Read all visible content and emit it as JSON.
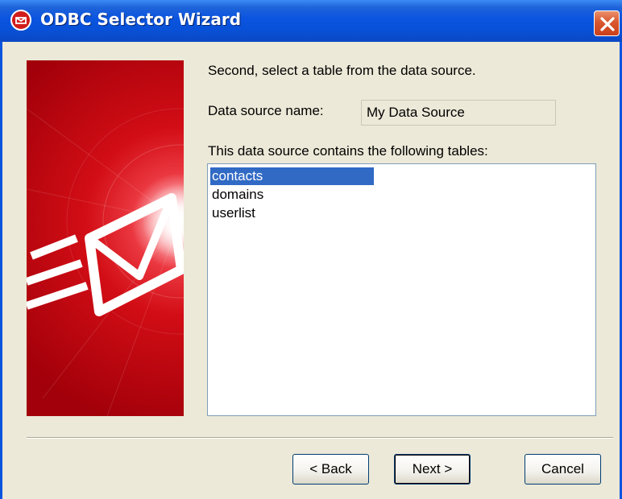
{
  "window": {
    "title": "ODBC Selector Wizard",
    "title_bar_color": "#0a54e0",
    "close_icon": "close-icon"
  },
  "content": {
    "instruction": "Second, select a table from the data source.",
    "data_source_label": "Data source name:",
    "data_source_value": "My Data Source",
    "tables_label": "This data source contains the following tables:",
    "tables": [
      {
        "name": "contacts",
        "selected": true
      },
      {
        "name": "domains",
        "selected": false
      },
      {
        "name": "userlist",
        "selected": false
      }
    ],
    "selection_color": "#316ac5"
  },
  "buttons": {
    "back": "< Back",
    "next": "Next >",
    "cancel": "Cancel"
  },
  "banner": {
    "icon": "envelope-icon",
    "color": "#d10a12"
  }
}
